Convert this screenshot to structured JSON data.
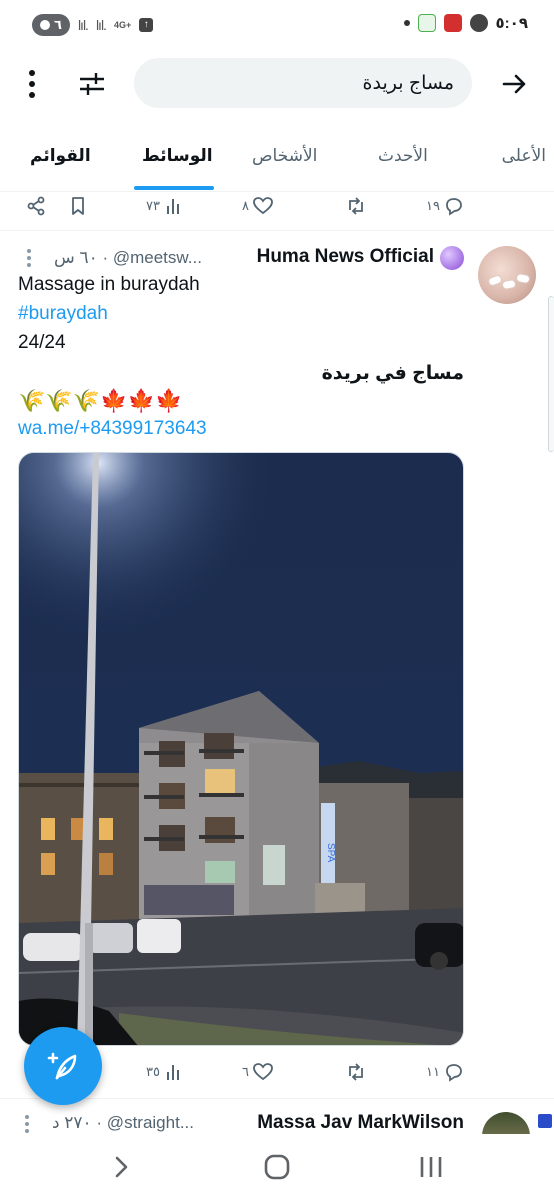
{
  "status_bar": {
    "time": "٥:٠٩",
    "pill_count": "٦",
    "network": "4G+",
    "signal_1": "lıl.",
    "signal_2": "lıl."
  },
  "search": {
    "query": "مساج بريدة"
  },
  "tabs": [
    {
      "label": "الأعلى",
      "active": false
    },
    {
      "label": "الأحدث",
      "active": false
    },
    {
      "label": "الأشخاص",
      "active": false
    },
    {
      "label": "الوسائط",
      "active": true
    },
    {
      "label": "القوائم",
      "active": false
    }
  ],
  "top_actions": {
    "views": "٧٣",
    "likes": "٨",
    "replies": "١٩"
  },
  "tweet": {
    "display_name": "Huma News Official",
    "handle_time": "٦٠ س · @meetsw...",
    "line1": "Massage in buraydah",
    "hashtag": "#buraydah",
    "line3": "24/24",
    "arabic_line": "مساج في بريدة",
    "emoji_line": "🌾🌾🌾🍁🍁🍁",
    "link": "wa.me/+84399173643",
    "photo_sign": "SPA",
    "actions": {
      "views": "٣٥",
      "likes": "٦",
      "replies": "١١"
    }
  },
  "tweet2": {
    "display_name": "Massa  Jav MarkWilson",
    "handle_time": "٢٧٠ د · @straight..."
  },
  "colors": {
    "accent": "#1d9bf0",
    "text": "#0f1419",
    "muted": "#536471"
  }
}
